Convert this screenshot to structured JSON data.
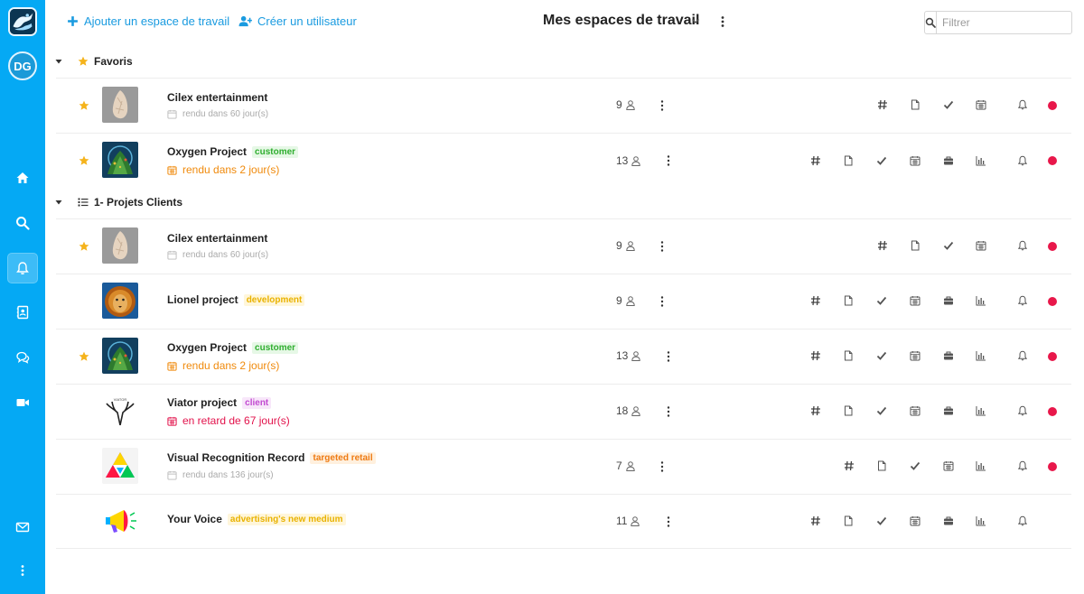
{
  "sidebar": {
    "avatar_initials": "DG",
    "items": [
      {
        "icon": "home-icon"
      },
      {
        "icon": "search-icon"
      },
      {
        "icon": "bell-icon",
        "active": true
      },
      {
        "icon": "contacts-icon"
      },
      {
        "icon": "chat-icon"
      },
      {
        "icon": "video-icon"
      }
    ],
    "bottom": [
      {
        "icon": "mail-icon"
      },
      {
        "icon": "more-icon"
      }
    ],
    "color": "#05a9f4"
  },
  "topbar": {
    "add_workspace": "Ajouter un espace de travail",
    "create_user": "Créer un utilisateur",
    "title": "Mes espaces de travail",
    "filter_placeholder": "Filtrer"
  },
  "groups": {
    "favorites": "Favoris",
    "client_projects": "1- Projets Clients"
  },
  "rows": [
    {
      "name": "Cilex entertainment",
      "badge": "",
      "due": "rendu dans 60 jour(s)",
      "members": "9"
    },
    {
      "name": "Oxygen Project",
      "badge": "customer",
      "due": "rendu dans 2 jour(s)",
      "members": "13"
    },
    {
      "name": "Cilex entertainment",
      "badge": "",
      "due": "rendu dans 60 jour(s)",
      "members": "9"
    },
    {
      "name": "Lionel project",
      "badge": "development",
      "due": "",
      "members": "9"
    },
    {
      "name": "Oxygen Project",
      "badge": "customer",
      "due": "rendu dans 2 jour(s)",
      "members": "13"
    },
    {
      "name": "Viator project",
      "badge": "client",
      "due": "en retard de 67 jour(s)",
      "members": "18"
    },
    {
      "name": "Visual Recognition Record",
      "badge": "targeted retail",
      "due": "rendu dans 136 jour(s)",
      "members": "7"
    },
    {
      "name": "Your Voice",
      "badge": "advertising's new medium",
      "due": "",
      "members": "11"
    }
  ],
  "colors": {
    "accent": "#1a9be0",
    "star": "#f5b31b",
    "status_red": "#e8174a",
    "due_orange": "#f08a0c",
    "due_red": "#e2124b"
  }
}
